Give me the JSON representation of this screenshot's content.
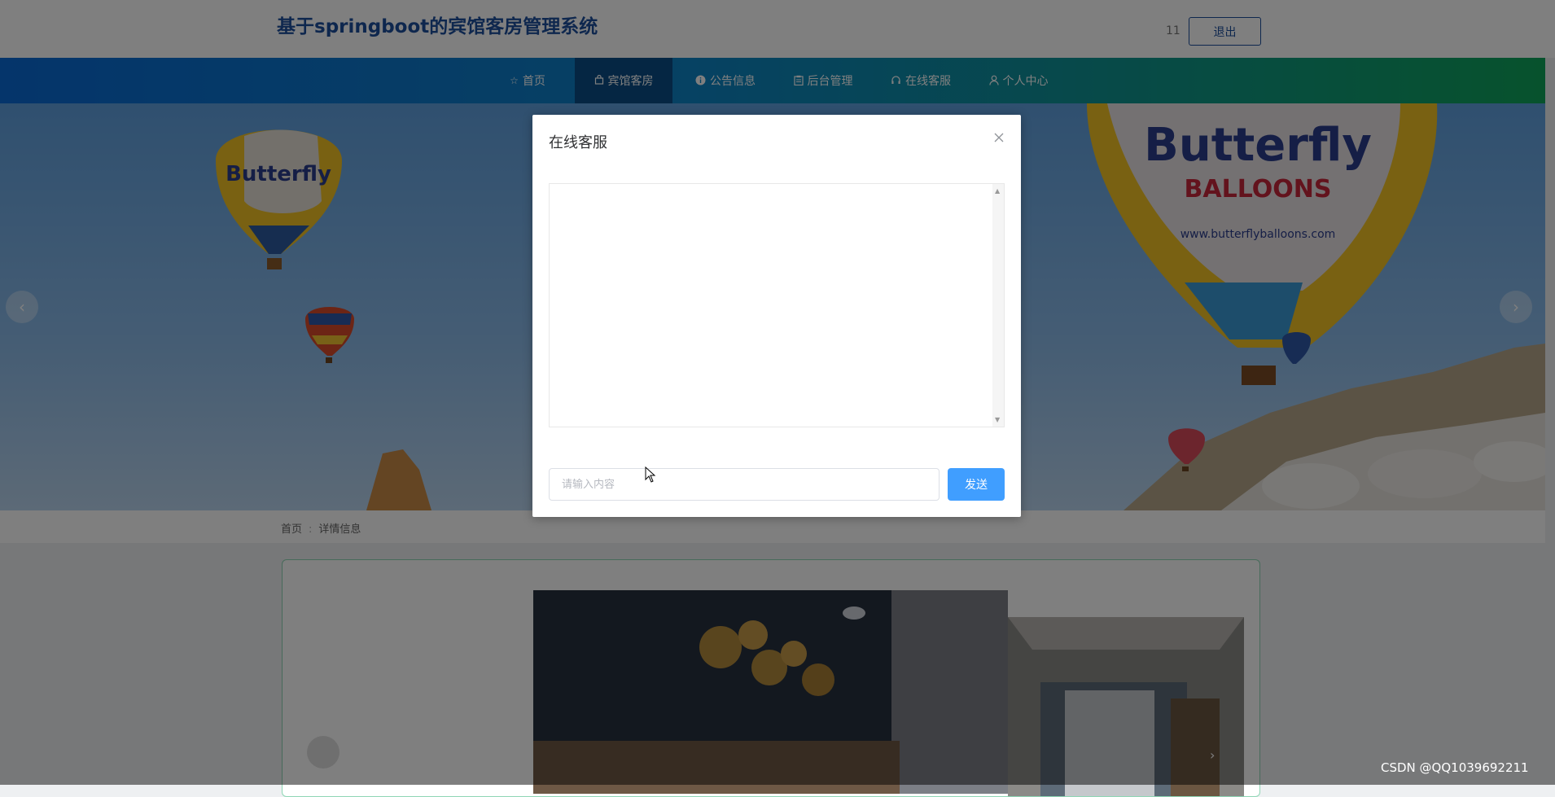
{
  "header": {
    "site_title": "基于springboot的宾馆客房管理系统",
    "username": "11",
    "logout_label": "退出"
  },
  "nav": {
    "items": [
      {
        "icon": "star-icon",
        "label": "首页"
      },
      {
        "icon": "bag-icon",
        "label": "宾馆客房"
      },
      {
        "icon": "info-icon",
        "label": "公告信息"
      },
      {
        "icon": "clipboard-icon",
        "label": "后台管理"
      },
      {
        "icon": "headset-icon",
        "label": "在线客服"
      },
      {
        "icon": "user-icon",
        "label": "个人中心"
      }
    ],
    "active_index": 1
  },
  "breadcrumb": {
    "home": "首页",
    "separator": ":",
    "current": "详情信息"
  },
  "chat_dialog": {
    "title": "在线客服",
    "input_placeholder": "请输入内容",
    "input_value": "",
    "send_label": "发送"
  },
  "banner_image": {
    "balloon_text_1": "Butterfly",
    "balloon_text_2": "BALLOONS",
    "balloon_url": "www.butterflyballoons.com"
  },
  "watermark": "CSDN @QQ1039692211",
  "colors": {
    "brand": "#1d4e9c",
    "send_button": "#409eff",
    "nav_active": "#0b4d86"
  }
}
